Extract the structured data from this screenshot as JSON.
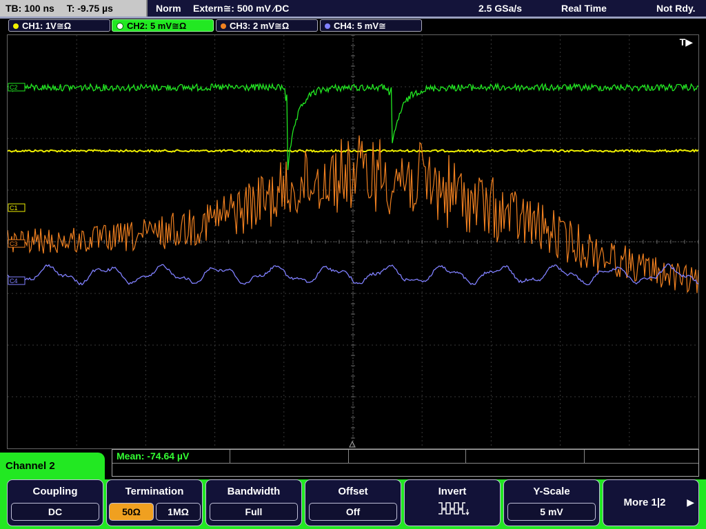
{
  "topbar": {
    "timebase": "TB: 100 ns",
    "trigger_time": "T: -9.75 µs",
    "mode": "Norm",
    "trigger": "Extern≅: 500 mV ⁄DC",
    "sample_rate": "2.5 GSa/s",
    "acq_mode": "Real Time",
    "status": "Not Rdy."
  },
  "channels": [
    {
      "label": "CH1: 1V≅Ω",
      "color": "#f0f000"
    },
    {
      "label": "CH2: 5 mV≅Ω",
      "color": "#22e822"
    },
    {
      "label": "CH3: 2 mV≅Ω",
      "color": "#f08020"
    },
    {
      "label": "CH4: 5 mV≅",
      "color": "#8080ff"
    }
  ],
  "screen": {
    "trigger_marker": "T▶",
    "markers": {
      "c1": "C1",
      "c2": "C2",
      "c3": "C3",
      "c4": "C4"
    }
  },
  "measurement": {
    "mean": "Mean: -74.64 µV"
  },
  "menu": {
    "title": "Channel 2",
    "coupling": {
      "label": "Coupling",
      "value": "DC"
    },
    "termination": {
      "label": "Termination",
      "opt1": "50Ω",
      "opt2": "1MΩ",
      "selected": "50Ω"
    },
    "bandwidth": {
      "label": "Bandwidth",
      "value": "Full"
    },
    "offset": {
      "label": "Offset",
      "value": "Off"
    },
    "invert": {
      "label": "Invert"
    },
    "yscale": {
      "label": "Y-Scale",
      "value": "5 mV"
    },
    "more": {
      "label": "More 1|2",
      "arrow": "▶"
    }
  }
}
